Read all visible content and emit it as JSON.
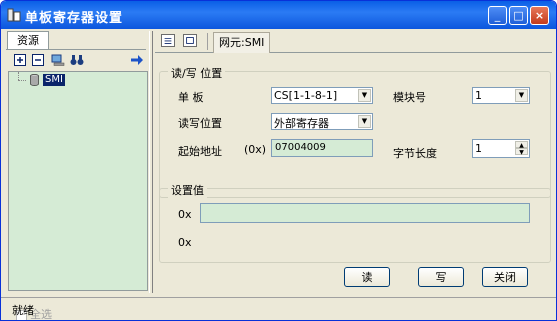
{
  "window": {
    "title": "单板寄存器设置",
    "buttons": {
      "minimize": "_",
      "maximize": "□",
      "close": "×"
    }
  },
  "resources": {
    "tab_label": "资源",
    "toolbar_icons": [
      "expand-icon",
      "collapse-icon",
      "computer-icon",
      "binoculars-icon",
      "arrow-right-icon"
    ],
    "tree": [
      {
        "label": "SMI",
        "icon": "database-icon",
        "selected": true
      }
    ],
    "select_all_label": "全选"
  },
  "right": {
    "network_element_tab": "网元:SMI",
    "read_write_group": {
      "legend": "读/写 位置",
      "board_label": "单    板",
      "board_value": "CS[1-1-8-1]",
      "module_label": "模块号",
      "module_value": "1",
      "rw_position_label": "读写位置",
      "rw_position_value": "外部寄存器",
      "start_addr_label": "起始地址",
      "hex_prefix": "(0x)",
      "start_addr_value": "07004009",
      "byte_len_label": "字节长度",
      "byte_len_value": "1"
    },
    "set_value_group": {
      "legend": "设置值",
      "prefix_1": "0x",
      "input_value": "",
      "prefix_2": "0x"
    }
  },
  "actions": {
    "read": "读",
    "write": "写",
    "close": "关闭"
  },
  "status": {
    "text": "就绪"
  },
  "colors": {
    "titlebar": "#0a5fe6",
    "panel": "#ece9d8",
    "tree_bg": "#d5ebd5",
    "selection": "#0a246a"
  }
}
